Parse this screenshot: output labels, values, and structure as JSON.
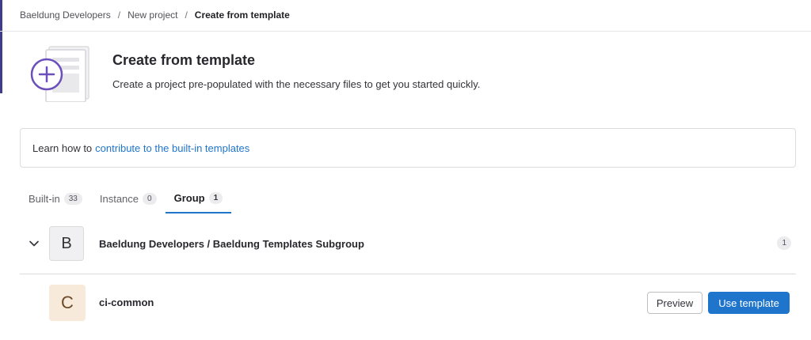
{
  "breadcrumb": {
    "items": [
      "Baeldung Developers",
      "New project"
    ],
    "current": "Create from template",
    "separator": "/"
  },
  "header": {
    "title": "Create from template",
    "subtitle": "Create a project pre-populated with the necessary files to get you started quickly.",
    "icon": "template-plus-icon"
  },
  "info": {
    "text": "Learn how to",
    "link_text": "contribute to the built-in templates"
  },
  "tabs": [
    {
      "label": "Built-in",
      "count": "33",
      "active": false
    },
    {
      "label": "Instance",
      "count": "0",
      "active": false
    },
    {
      "label": "Group",
      "count": "1",
      "active": true
    }
  ],
  "group": {
    "avatar_letter": "B",
    "name": "Baeldung Developers / Baeldung Templates Subgroup",
    "count": "1",
    "icon": "chevron-down-icon"
  },
  "project": {
    "avatar_letter": "C",
    "name": "ci-common",
    "preview_label": "Preview",
    "use_label": "Use template"
  },
  "colors": {
    "accent": "#1f75cb",
    "illustration_purple": "#6b4fbb",
    "sidebar_edge": "#3f3d8a",
    "project_avatar_bg": "#f7eadb"
  }
}
